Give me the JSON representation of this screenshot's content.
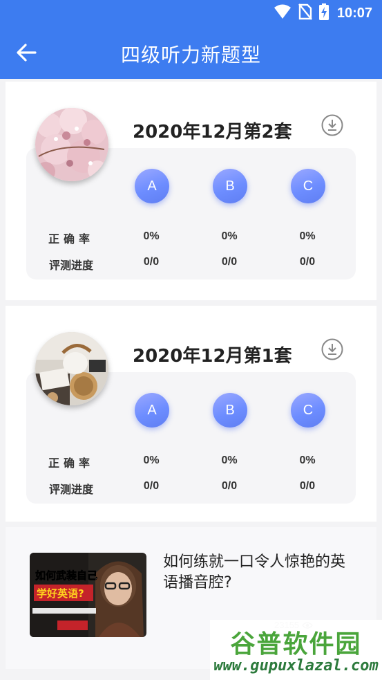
{
  "status_bar": {
    "time": "10:07",
    "icons": [
      "wifi-icon",
      "no-sim-icon",
      "battery-charging-icon"
    ]
  },
  "app_bar": {
    "title": "四级听力新题型",
    "back_icon": "arrow-left-icon"
  },
  "exam_sets": [
    {
      "title": "2020年12月第2套",
      "thumbnail": "cherry-blossom-image",
      "sections": [
        "A",
        "B",
        "C"
      ],
      "accuracy_label": "正确率",
      "progress_label": "评测进度",
      "accuracy": [
        "0%",
        "0%",
        "0%"
      ],
      "progress": [
        "0/0",
        "0/0",
        "0/0"
      ]
    },
    {
      "title": "2020年12月第1套",
      "thumbnail": "teapot-tea-image",
      "sections": [
        "A",
        "B",
        "C"
      ],
      "accuracy_label": "正确率",
      "progress_label": "评测进度",
      "accuracy": [
        "0%",
        "0%",
        "0%"
      ],
      "progress": [
        "0/0",
        "0/0",
        "0/0"
      ]
    }
  ],
  "article": {
    "title": "如何练就一口令人惊艳的英语播音腔?",
    "views": "23155",
    "image_text": "如何武装自己 学好英语?"
  },
  "watermark": {
    "main": "谷普软件园",
    "url": "www.gupuxlazal.com"
  },
  "colors": {
    "primary": "#3d7cf0",
    "button_gradient_start": "#9aa8ff",
    "button_gradient_end": "#5f7ef2",
    "watermark_green": "#4aa53b"
  }
}
